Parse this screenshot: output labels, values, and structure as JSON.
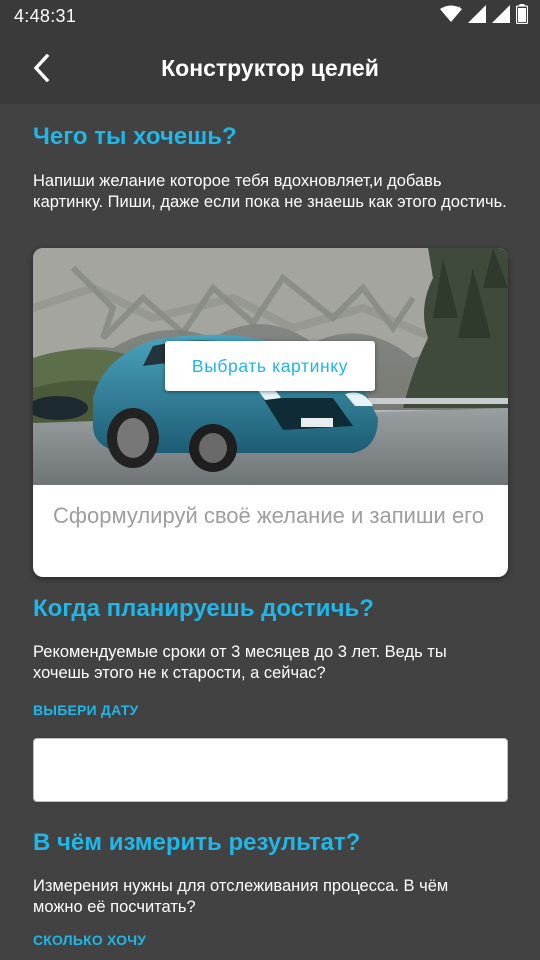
{
  "status_bar": {
    "time": "4:48:31",
    "icons": [
      "wifi-icon",
      "signal-icon",
      "signal-icon",
      "battery-icon"
    ]
  },
  "app_bar": {
    "title": "Конструктор целей",
    "back_icon": "chevron-left-icon"
  },
  "colors": {
    "accent": "#1fb6e8",
    "background": "#424242",
    "app_bar": "#3a3a3a"
  },
  "section_want": {
    "title": "Чего ты хочешь?",
    "description": "Напиши желание которое тебя вдохновляет,и добавь картинку. Пиши, даже если пока не знаешь как этого достичь."
  },
  "card": {
    "pick_image_label": "Выбрать картинку",
    "wish_placeholder": "Сформулируй своё желание и запиши его"
  },
  "section_when": {
    "title": "Когда планируешь достичь?",
    "description": "Рекомендуемые сроки от 3 месяцев до 3 лет. Ведь ты хочешь этого не к старости, а сейчас?",
    "link": "ВЫБЕРИ ДАТУ",
    "date_value": ""
  },
  "section_measure": {
    "title": "В чём измерить результат?",
    "description": "Измерения нужны для отслеживания процесса. В чём можно её посчитать?",
    "link": "СКОЛЬКО ХОЧУ"
  }
}
